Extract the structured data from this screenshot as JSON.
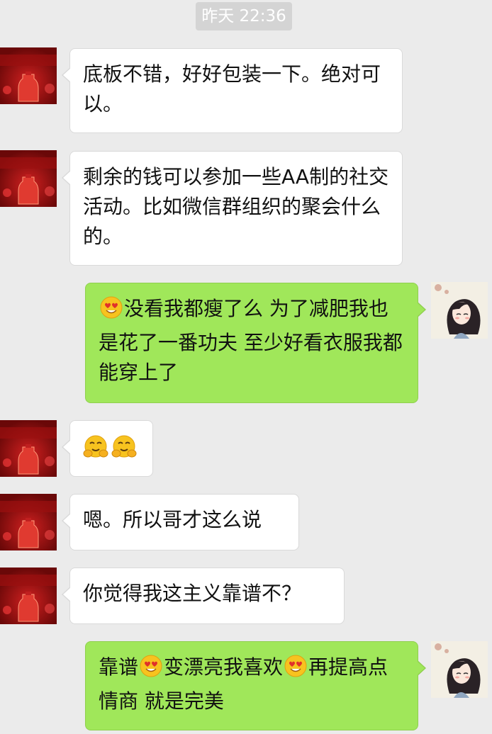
{
  "timestamp": "昨天 22:36",
  "colors": {
    "background": "#ebebeb",
    "incoming_bubble": "#ffffff",
    "outgoing_bubble": "#a0e75a"
  },
  "messages": [
    {
      "side": "in",
      "text": "底板不错，好好包装一下。绝对可以。"
    },
    {
      "side": "in",
      "text": "剩余的钱可以参加一些AA制的社交活动。比如微信群组织的聚会什么的。"
    },
    {
      "side": "out",
      "parts": [
        {
          "emoji": "heart-eyes-emoji"
        },
        {
          "text": "没看我都瘦了么  为了减肥我也是花了一番功夫  至少好看衣服我都能穿上了"
        }
      ]
    },
    {
      "side": "in",
      "parts": [
        {
          "emoji": "hug-emoji"
        },
        {
          "emoji": "hug-emoji"
        }
      ]
    },
    {
      "side": "in",
      "text": "嗯。所以哥才这么说"
    },
    {
      "side": "in",
      "text": "你觉得我这主义靠谱不？"
    },
    {
      "side": "out",
      "parts": [
        {
          "text": "靠谱"
        },
        {
          "emoji": "heart-eyes-emoji"
        },
        {
          "text": "变漂亮我喜欢"
        },
        {
          "emoji": "heart-eyes-emoji"
        },
        {
          "text": "再提高点情商  就是完美"
        }
      ]
    }
  ]
}
